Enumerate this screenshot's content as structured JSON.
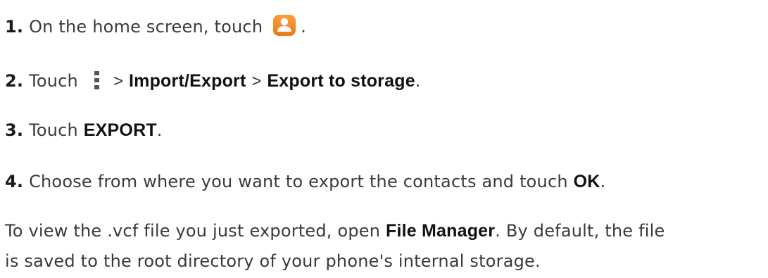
{
  "steps": [
    {
      "number": "1.",
      "text_before": "On the home screen, touch",
      "icon": "contacts-app-icon",
      "text_after": "."
    },
    {
      "number": "2.",
      "text_before": "Touch",
      "icon": "more-menu-icon",
      "separator": ">",
      "item1": "Import/Export",
      "item2": "Export to storage",
      "text_after": "."
    },
    {
      "number": "3.",
      "text_before": "Touch",
      "bold": "EXPORT",
      "text_after": "."
    },
    {
      "number": "4.",
      "text_before": "Choose from where you want to export the contacts and touch",
      "bold": "OK",
      "text_after": "."
    }
  ],
  "note": {
    "before": "To view the .vcf file you just exported, open",
    "bold": "File Manager",
    "after": ". By default, the file",
    "line2": "is saved to the root directory of your phone's internal storage."
  },
  "colors": {
    "icon_orange": "#f08a24",
    "text": "#3a3a3a"
  }
}
